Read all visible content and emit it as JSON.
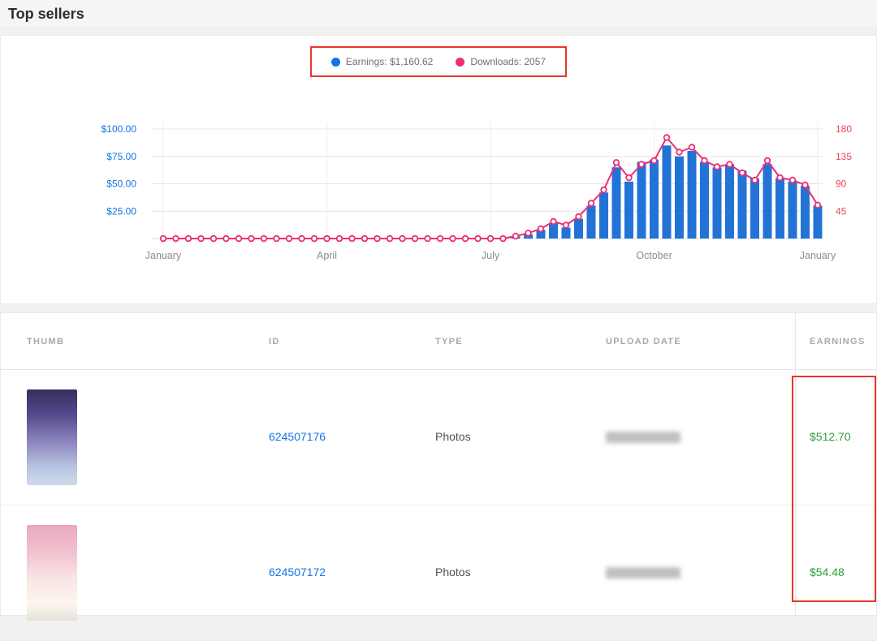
{
  "header": {
    "title": "Top sellers"
  },
  "legend": {
    "earnings": {
      "label": "Earnings: $1,160.62",
      "color": "#1473e6"
    },
    "downloads": {
      "label": "Downloads: 2057",
      "color": "#ec2d77"
    },
    "annotation_color": "#e8352b"
  },
  "chart_data": {
    "type": "bar",
    "title": "Top sellers: weekly earnings (bars) and downloads (line)",
    "x_tick_labels": [
      "January",
      "April",
      "July",
      "October",
      "January"
    ],
    "x_tick_indices": [
      0,
      13,
      26,
      39,
      52
    ],
    "left_axis": {
      "label": "Earnings",
      "ticks": [
        "$25.00",
        "$50.00",
        "$75.00",
        "$100.00"
      ],
      "max": 100,
      "color": "#1473e6"
    },
    "right_axis": {
      "label": "Downloads",
      "ticks": [
        "45",
        "90",
        "135",
        "180"
      ],
      "max": 180,
      "color": "#e8485b"
    },
    "grid": true,
    "legend_position": "top-center",
    "series": [
      {
        "name": "Earnings",
        "type": "bar",
        "color": "#2373d6",
        "values": [
          0,
          0,
          0,
          0,
          0,
          0,
          0,
          0,
          0,
          0,
          0,
          0,
          0,
          0,
          0,
          0,
          0,
          0,
          0,
          0,
          0,
          0,
          0,
          0,
          0,
          0,
          0,
          0,
          2,
          4,
          8,
          14,
          10,
          18,
          30,
          42,
          65,
          52,
          70,
          72,
          85,
          75,
          80,
          70,
          65,
          68,
          62,
          55,
          68,
          55,
          52,
          48,
          30
        ]
      },
      {
        "name": "Downloads",
        "type": "line",
        "color": "#ec2d77",
        "values": [
          0,
          0,
          0,
          0,
          0,
          0,
          0,
          0,
          0,
          0,
          0,
          0,
          0,
          0,
          0,
          0,
          0,
          0,
          0,
          0,
          0,
          0,
          0,
          0,
          0,
          0,
          0,
          0,
          4,
          9,
          16,
          28,
          22,
          36,
          58,
          80,
          125,
          100,
          122,
          128,
          166,
          142,
          150,
          128,
          118,
          122,
          108,
          96,
          128,
          100,
          96,
          88,
          55
        ]
      }
    ],
    "totals": {
      "earnings": "$1,160.62",
      "downloads": 2057
    }
  },
  "table": {
    "columns": [
      "THUMB",
      "ID",
      "TYPE",
      "UPLOAD DATE",
      "EARNINGS"
    ],
    "link_color": "#1473e6",
    "earnings_color": "#2d9d3a",
    "annotation_color": "#e8352b",
    "rows": [
      {
        "id": "624507176",
        "type": "Photos",
        "upload_date_redacted": true,
        "earnings": "$512.70"
      },
      {
        "id": "624507172",
        "type": "Photos",
        "upload_date_redacted": true,
        "earnings": "$54.48"
      }
    ]
  }
}
